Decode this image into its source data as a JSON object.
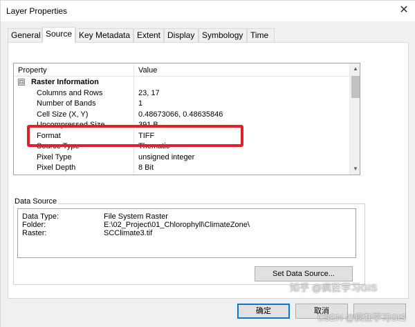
{
  "window": {
    "title": "Layer Properties",
    "close_glyph": "✕"
  },
  "tabs": [
    {
      "label": "General",
      "active": false
    },
    {
      "label": "Source",
      "active": true
    },
    {
      "label": "Key Metadata",
      "active": false
    },
    {
      "label": "Extent",
      "active": false
    },
    {
      "label": "Display",
      "active": false
    },
    {
      "label": "Symbology",
      "active": false
    },
    {
      "label": "Time",
      "active": false
    }
  ],
  "property_grid": {
    "headers": {
      "property": "Property",
      "value": "Value"
    },
    "group": {
      "label": "Raster Information",
      "expander": "⊟"
    },
    "rows": [
      {
        "name": "Columns and Rows",
        "value": "23, 17"
      },
      {
        "name": "Number of Bands",
        "value": "1"
      },
      {
        "name": "Cell Size (X, Y)",
        "value": "0.48673066, 0.48635846"
      },
      {
        "name": "Uncompressed Size",
        "value": "391 B"
      },
      {
        "name": "Format",
        "value": "TIFF"
      },
      {
        "name": "Source Type",
        "value": "Thematic"
      },
      {
        "name": "Pixel Type",
        "value": "unsigned integer"
      },
      {
        "name": "Pixel Depth",
        "value": "8 Bit"
      }
    ],
    "highlighted_row": "Cell Size (X, Y)",
    "highlight_color": "#e0202a"
  },
  "data_source": {
    "title": "Data Source",
    "rows": [
      {
        "label": "Data Type:",
        "value": "File System Raster"
      },
      {
        "label": "Folder:",
        "value": "E:\\02_Project\\01_Chlorophyll\\ClimateZone\\"
      },
      {
        "label": "Raster:",
        "value": "SCClimate3.tif"
      }
    ],
    "button_label": "Set Data Source..."
  },
  "buttons": {
    "ok": "确定",
    "cancel": "取消",
    "apply": ""
  },
  "watermarks": {
    "zhihu": "知乎 @疯狂学习GIS",
    "csdn": "CSDN @疯狂学习GIS"
  },
  "colors": {
    "accent": "#0078d7",
    "panel_bg": "#f0f0f0"
  }
}
